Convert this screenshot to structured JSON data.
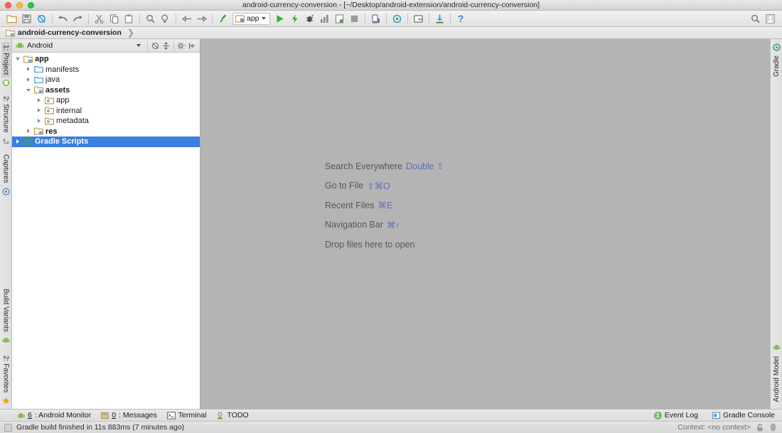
{
  "window": {
    "title": "android-currency-conversion - [~/Desktop/android-extension/android-currency-conversion]",
    "controls": {
      "close": "close-button",
      "minimize": "minimize-button",
      "zoom": "zoom-button"
    }
  },
  "toolbar": {
    "buttons": [
      {
        "name": "open-project-icon",
        "tooltip": "Open"
      },
      {
        "name": "save-all-icon",
        "tooltip": "Save All"
      },
      {
        "name": "sync-icon",
        "tooltip": "Synchronize"
      },
      {
        "name": "undo-icon",
        "tooltip": "Undo"
      },
      {
        "name": "redo-icon",
        "tooltip": "Redo"
      },
      {
        "name": "cut-icon",
        "tooltip": "Cut"
      },
      {
        "name": "copy-icon",
        "tooltip": "Copy"
      },
      {
        "name": "paste-icon",
        "tooltip": "Paste"
      },
      {
        "name": "find-icon",
        "tooltip": "Find"
      },
      {
        "name": "replace-icon",
        "tooltip": "Replace"
      },
      {
        "name": "back-icon",
        "tooltip": "Back"
      },
      {
        "name": "forward-icon",
        "tooltip": "Forward"
      },
      {
        "name": "build-hammer-icon",
        "tooltip": "Make Project"
      }
    ],
    "run_config": {
      "label": "app",
      "icon": "android-module-icon"
    },
    "action_buttons": [
      {
        "name": "run-icon",
        "tooltip": "Run"
      },
      {
        "name": "apply-changes-icon",
        "tooltip": "Apply Changes"
      },
      {
        "name": "debug-icon",
        "tooltip": "Debug"
      },
      {
        "name": "run-with-coverage-icon",
        "tooltip": "Run with Coverage"
      },
      {
        "name": "profile-icon",
        "tooltip": "Profile"
      },
      {
        "name": "stop-icon",
        "tooltip": "Stop"
      },
      {
        "name": "avd-manager-icon",
        "tooltip": "AVD Manager"
      },
      {
        "name": "sync-gradle-icon",
        "tooltip": "Sync Project with Gradle Files"
      },
      {
        "name": "sdk-manager-icon",
        "tooltip": "SDK Manager"
      },
      {
        "name": "download-icon",
        "tooltip": "Download"
      },
      {
        "name": "help-icon",
        "tooltip": "Help",
        "glyph": "?"
      }
    ],
    "right_buttons": [
      {
        "name": "search-everywhere-icon",
        "tooltip": "Search Everywhere"
      },
      {
        "name": "user-account-icon",
        "tooltip": "Account"
      }
    ]
  },
  "breadcrumb": {
    "icon": "project-folder-icon",
    "label": "android-currency-conversion",
    "separator": "❯"
  },
  "left_strip": {
    "top": [
      {
        "name": "sidebar-item-project",
        "label": "1: Project",
        "icon": "android-icon",
        "active": true
      },
      {
        "name": "sidebar-item-structure",
        "label": "2: Structure",
        "icon": "structure-icon",
        "active": false
      },
      {
        "name": "sidebar-item-captures",
        "label": "Captures",
        "icon": "captures-icon",
        "active": false
      }
    ],
    "bottom": [
      {
        "name": "sidebar-item-build-variants",
        "label": "Build Variants",
        "icon": "android-icon",
        "active": false
      },
      {
        "name": "sidebar-item-favorites",
        "label": "2: Favorites",
        "icon": "star-icon",
        "active": false
      }
    ]
  },
  "right_strip": {
    "top": [
      {
        "name": "sidebar-item-gradle",
        "label": "Gradle",
        "icon": "gradle-icon",
        "active": false
      }
    ],
    "bottom": [
      {
        "name": "sidebar-item-android-model",
        "label": "Android Model",
        "icon": "android-icon",
        "active": false
      }
    ]
  },
  "project_panel": {
    "view_selector": {
      "label": "Android",
      "icon": "android-icon"
    },
    "header_buttons": [
      {
        "name": "collapse-all-icon",
        "tooltip": "Collapse All"
      },
      {
        "name": "scroll-from-source-icon",
        "tooltip": "Scroll from Source"
      },
      {
        "name": "settings-gear-icon",
        "tooltip": "Settings"
      },
      {
        "name": "hide-panel-icon",
        "tooltip": "Hide"
      }
    ],
    "tree": [
      {
        "label": "app",
        "indent": 0,
        "twist": "open",
        "icon": "module-folder-icon",
        "bold": true,
        "selected": false
      },
      {
        "label": "manifests",
        "indent": 1,
        "twist": "closed",
        "icon": "folder-icon",
        "bold": false,
        "selected": false
      },
      {
        "label": "java",
        "indent": 1,
        "twist": "closed",
        "icon": "folder-icon",
        "bold": false,
        "selected": false
      },
      {
        "label": "assets",
        "indent": 1,
        "twist": "open",
        "icon": "module-folder-icon",
        "bold": true,
        "selected": false
      },
      {
        "label": "app",
        "indent": 2,
        "twist": "closed",
        "icon": "assets-folder-icon",
        "bold": false,
        "selected": false
      },
      {
        "label": "internal",
        "indent": 2,
        "twist": "closed",
        "icon": "assets-folder-icon",
        "bold": false,
        "selected": false
      },
      {
        "label": "metadata",
        "indent": 2,
        "twist": "closed",
        "icon": "assets-folder-icon",
        "bold": false,
        "selected": false
      },
      {
        "label": "res",
        "indent": 1,
        "twist": "closed",
        "icon": "module-folder-icon",
        "bold": true,
        "selected": false
      },
      {
        "label": "Gradle Scripts",
        "indent": 0,
        "twist": "closed",
        "icon": "gradle-icon",
        "bold": true,
        "selected": true
      }
    ]
  },
  "editor": {
    "hints": [
      {
        "name": "hint-search-everywhere",
        "text": "Search Everywhere",
        "shortcut": "Double ⇧"
      },
      {
        "name": "hint-go-to-file",
        "text": "Go to File",
        "shortcut": "⇧⌘O"
      },
      {
        "name": "hint-recent-files",
        "text": "Recent Files",
        "shortcut": "⌘E"
      },
      {
        "name": "hint-navigation-bar",
        "text": "Navigation Bar",
        "shortcut": "⌘↑"
      },
      {
        "name": "hint-drop-files",
        "text": "Drop files here to open",
        "shortcut": ""
      }
    ]
  },
  "bottom_bar": {
    "left_tabs": [
      {
        "name": "bottom-tab-android-monitor",
        "num": "6",
        "label": ": Android Monitor",
        "icon": "android-icon"
      },
      {
        "name": "bottom-tab-messages",
        "num": "0",
        "label": ": Messages",
        "icon": "messages-icon"
      },
      {
        "name": "bottom-tab-terminal",
        "num": "",
        "label": "Terminal",
        "icon": "terminal-icon"
      },
      {
        "name": "bottom-tab-todo",
        "num": "",
        "label": "TODO",
        "icon": "todo-icon"
      }
    ],
    "right_tabs": [
      {
        "name": "bottom-tab-event-log",
        "label": "Event Log",
        "icon": "event-log-icon",
        "badge": "1"
      },
      {
        "name": "bottom-tab-gradle-console",
        "label": "Gradle Console",
        "icon": "gradle-console-icon",
        "badge": ""
      }
    ]
  },
  "status_bar": {
    "message": "Gradle build finished in 11s 883ms (7 minutes ago)",
    "context": "Context: <no context>",
    "icons": [
      {
        "name": "lock-icon"
      },
      {
        "name": "memory-indicator-icon"
      }
    ]
  },
  "colors": {
    "selection_blue": "#3b7fe0",
    "editor_bg": "#b4b4b4",
    "hint_key_blue": "#5c72b5",
    "android_green": "#7fbb42",
    "badge_green": "#6ac259",
    "folder_blue": "#5a9bd5",
    "module_orange": "#d8a449"
  }
}
